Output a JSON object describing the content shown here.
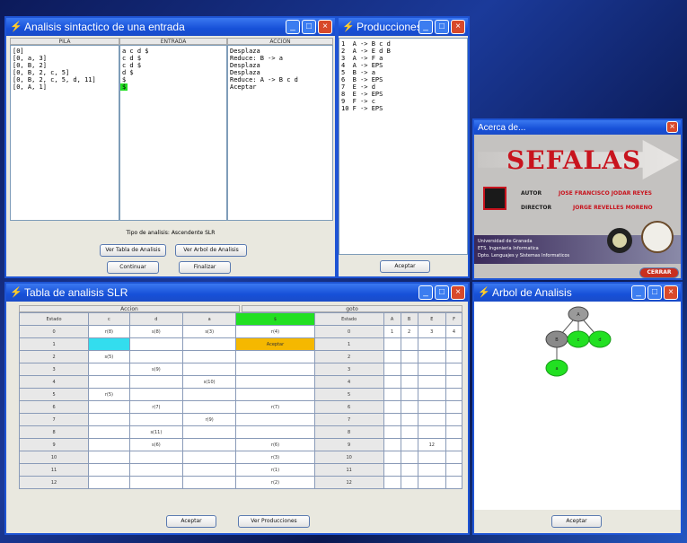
{
  "win_analysis": {
    "title": "Analisis sintactico de una entrada",
    "col_pila": "PILA",
    "col_entrada": "ENTRADA",
    "col_accion": "ACCION",
    "pila": [
      "[0]",
      "[0, a, 3]",
      "[0, B, 2]",
      "[0, B, 2, c, 5]",
      "[0, B, 2, c, 5, d, 11]",
      "[0, A, 1]"
    ],
    "entrada": [
      "a c d $",
      "c d $",
      "c d $",
      "d $",
      "$",
      "$"
    ],
    "accion": [
      "Desplaza",
      "Reduce: B -> a",
      "Desplaza",
      "Desplaza",
      "Reduce: A -> B c d",
      "Aceptar"
    ],
    "tipo": "Tipo de analisis: Ascendente SLR",
    "btn_tabla": "Ver Tabla de Analisis",
    "btn_arbol": "Ver Arbol de Analisis",
    "btn_continuar": "Continuar",
    "btn_finalizar": "Finalizar"
  },
  "win_producciones": {
    "title": "Producciones",
    "items": [
      "1  A -> B c d",
      "2  A -> E d B",
      "3  A -> F a",
      "4  A -> EPS",
      "5  B -> a",
      "6  B -> EPS",
      "7  E -> d",
      "8  E -> EPS",
      "9  F -> c",
      "10 F -> EPS"
    ],
    "btn_aceptar": "Aceptar"
  },
  "win_acerca": {
    "title": "Acerca de...",
    "logo": "SEFALAS",
    "autor_label": "AUTOR",
    "autor": "JOSE FRANCISCO JODAR REYES",
    "director_label": "DIRECTOR",
    "director": "JORGE REVELLES MORENO",
    "uni1": "Universidad de Granada",
    "uni2": "ETS. Ingenieria Informatica",
    "uni3": "Dpto. Lenguajes y Sistemas Informaticos",
    "btn_cerrar": "CERRAR"
  },
  "win_tabla": {
    "title": "Tabla de analisis SLR",
    "accion_label": "Accion",
    "goto_label": "goto",
    "estado_label": "Estado",
    "accion_cols": [
      "c",
      "d",
      "a",
      "$"
    ],
    "goto_cols": [
      "A",
      "B",
      "E",
      "F"
    ],
    "rows": [
      {
        "estado": "0",
        "accion": [
          "r(8)",
          "s(8)",
          "s(3)",
          "r(4)"
        ],
        "goto": [
          "1",
          "2",
          "3",
          "4"
        ]
      },
      {
        "estado": "1",
        "accion": [
          "",
          "",
          "",
          "Aceptar"
        ],
        "goto": [
          "",
          "",
          "",
          ""
        ]
      },
      {
        "estado": "2",
        "accion": [
          "s(5)",
          "",
          "",
          ""
        ],
        "goto": [
          "",
          "",
          "",
          ""
        ]
      },
      {
        "estado": "3",
        "accion": [
          "",
          "s(9)",
          "",
          ""
        ],
        "goto": [
          "",
          "",
          "",
          ""
        ]
      },
      {
        "estado": "4",
        "accion": [
          "",
          "",
          "s(10)",
          ""
        ],
        "goto": [
          "",
          "",
          "",
          ""
        ]
      },
      {
        "estado": "5",
        "accion": [
          "r(5)",
          "",
          "",
          ""
        ],
        "goto": [
          "",
          "",
          "",
          ""
        ]
      },
      {
        "estado": "6",
        "accion": [
          "",
          "r(7)",
          "",
          "r(7)"
        ],
        "goto": [
          "",
          "",
          "",
          ""
        ]
      },
      {
        "estado": "7",
        "accion": [
          "",
          "",
          "r(9)",
          ""
        ],
        "goto": [
          "",
          "",
          "",
          ""
        ]
      },
      {
        "estado": "8",
        "accion": [
          "",
          "s(11)",
          "",
          ""
        ],
        "goto": [
          "",
          "",
          "",
          ""
        ]
      },
      {
        "estado": "9",
        "accion": [
          "",
          "s(6)",
          "",
          "r(6)"
        ],
        "goto": [
          "",
          "",
          "12",
          ""
        ]
      },
      {
        "estado": "10",
        "accion": [
          "",
          "",
          "",
          "r(3)"
        ],
        "goto": [
          "",
          "",
          "",
          ""
        ]
      },
      {
        "estado": "11",
        "accion": [
          "",
          "",
          "",
          "r(1)"
        ],
        "goto": [
          "",
          "",
          "",
          ""
        ]
      },
      {
        "estado": "12",
        "accion": [
          "",
          "",
          "",
          "r(2)"
        ],
        "goto": [
          "",
          "",
          "",
          ""
        ]
      }
    ],
    "btn_aceptar": "Aceptar",
    "btn_producciones": "Ver Producciones"
  },
  "win_arbol": {
    "title": "Arbol de Analisis",
    "nodes": [
      "A",
      "B",
      "c",
      "d",
      "a"
    ],
    "btn_aceptar": "Aceptar"
  },
  "colors": {
    "titlebar": "#1650d8",
    "highlight_green": "#22e022",
    "highlight_cyan": "#33ddee",
    "highlight_orange": "#f5b800"
  }
}
